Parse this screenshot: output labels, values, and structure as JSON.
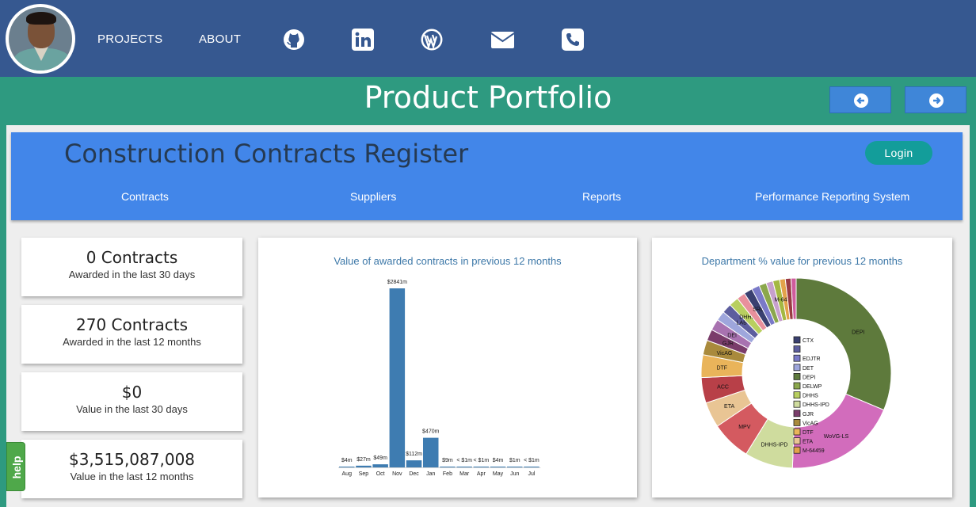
{
  "topnav": {
    "links": [
      {
        "label": "PROJECTS"
      },
      {
        "label": "ABOUT"
      }
    ],
    "icons": [
      "github-icon",
      "linkedin-icon",
      "wordpress-icon",
      "email-icon",
      "phone-icon"
    ]
  },
  "banner": {
    "title": "Product Portfolio"
  },
  "app": {
    "title": "Construction Contracts Register",
    "login_label": "Login",
    "nav": [
      "Contracts",
      "Suppliers",
      "Reports",
      "Performance Reporting System"
    ]
  },
  "stats": [
    {
      "value": "0 Contracts",
      "caption": "Awarded in the last 30 days"
    },
    {
      "value": "270 Contracts",
      "caption": "Awarded in the last 12 months"
    },
    {
      "value": "$0",
      "caption": "Value in the last 30 days"
    },
    {
      "value": "$3,515,087,008",
      "caption": "Value in the last 12 months"
    }
  ],
  "help_label": "help",
  "colors": {
    "topbar": "#365890",
    "banner": "#2e9a80",
    "app_header": "#4286e9",
    "bar": "#3e7cb1",
    "login": "#139d9a"
  },
  "chart_data": [
    {
      "type": "bar",
      "title": "Value of awarded contracts in previous 12 months",
      "categories": [
        "Aug",
        "Sep",
        "Oct",
        "Nov",
        "Dec",
        "Jan",
        "Feb",
        "Mar",
        "Apr",
        "May",
        "Jun",
        "Jul"
      ],
      "values": [
        4,
        27,
        49,
        2841,
        112,
        470,
        9,
        0.5,
        0.5,
        4,
        0.5,
        0.5
      ],
      "labels": [
        "$4m",
        "$27m",
        "$49m",
        "$2841m",
        "$112m",
        "$470m",
        "$9m",
        "< $1m",
        "< $1m",
        "$4m",
        "$1m",
        "< $1m"
      ],
      "ylim": [
        0,
        2841
      ],
      "xlabel": "",
      "ylabel": ""
    },
    {
      "type": "pie",
      "title": "Department % value for previous 12 months",
      "slices": [
        {
          "name": "DEPI",
          "value": 32.5,
          "color": "#5e7a3c"
        },
        {
          "name": "WoVG-LS",
          "value": 20.0,
          "color": "#d26cbc"
        },
        {
          "name": "DHHS-IPD",
          "value": 8.5,
          "color": "#cfdc9e"
        },
        {
          "name": "MPV",
          "value": 7.0,
          "color": "#d45a60"
        },
        {
          "name": "ETA",
          "value": 4.5,
          "color": "#e9c594"
        },
        {
          "name": "ACC",
          "value": 4.5,
          "color": "#b84048"
        },
        {
          "name": "DTF",
          "value": 4.0,
          "color": "#e9b45a"
        },
        {
          "name": "VicAG",
          "value": 2.6,
          "color": "#a98a3c"
        },
        {
          "name": "GJR",
          "value": 2.0,
          "color": "#7a3c6a"
        },
        {
          "name": "DEI",
          "value": 2.0,
          "color": "#a872b0"
        },
        {
          "name": "",
          "value": 1.7,
          "color": "#9ea6dc"
        },
        {
          "name": "LAB",
          "value": 1.7,
          "color": "#5d5e9e"
        },
        {
          "name": "DHHS",
          "value": 1.7,
          "color": "#b8cf60"
        },
        {
          "name": "",
          "value": 1.5,
          "color": "#e8909c"
        },
        {
          "name": "SRE",
          "value": 1.5,
          "color": "#3a4070"
        },
        {
          "name": "",
          "value": 1.4,
          "color": "#7a7ac8"
        },
        {
          "name": "",
          "value": 1.3,
          "color": "#8ba74c"
        },
        {
          "name": "",
          "value": 1.2,
          "color": "#c7a0cc"
        },
        {
          "name": "",
          "value": 1.2,
          "color": "#a4b842"
        },
        {
          "name": "M-64459",
          "value": 1.0,
          "color": "#e3a24a"
        },
        {
          "name": "",
          "value": 1.0,
          "color": "#9a3b44"
        },
        {
          "name": "",
          "value": 0.9,
          "color": "#cf5c9c"
        }
      ],
      "legend": [
        {
          "name": "CTX",
          "color": "#3a4070"
        },
        {
          "name": "",
          "color": "#5d5e9e"
        },
        {
          "name": "EDJTR",
          "color": "#7a7ac8"
        },
        {
          "name": "DET",
          "color": "#9ea6dc"
        },
        {
          "name": "DEPI",
          "color": "#5e7a3c"
        },
        {
          "name": "DELWP",
          "color": "#8ba74c"
        },
        {
          "name": "DHHS",
          "color": "#b8cf60"
        },
        {
          "name": "DHHS-IPD",
          "color": "#cfdc9e"
        },
        {
          "name": "GJR",
          "color": "#7a3c6a"
        },
        {
          "name": "VicAG",
          "color": "#a98a3c"
        },
        {
          "name": "DTF",
          "color": "#e9b45a"
        },
        {
          "name": "ETA",
          "color": "#e9c594"
        },
        {
          "name": "M-64459",
          "color": "#e3a24a"
        }
      ]
    }
  ]
}
